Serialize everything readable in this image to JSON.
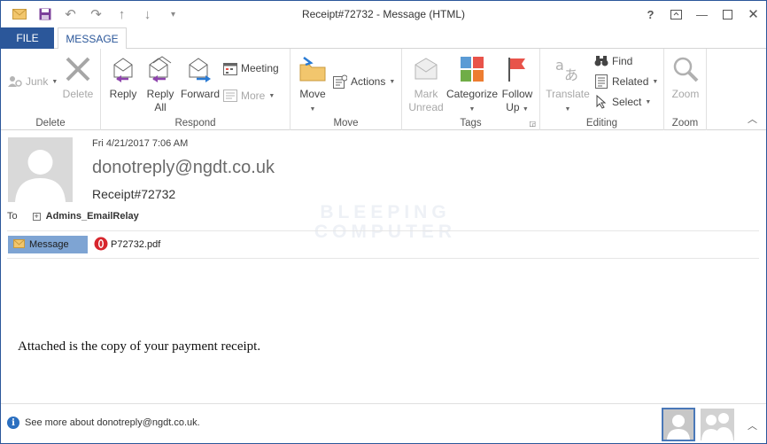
{
  "window": {
    "title": "Receipt#72732 - Message (HTML)",
    "help": "?"
  },
  "tabs": {
    "file": "FILE",
    "message": "MESSAGE"
  },
  "ribbon": {
    "delete_group": {
      "label": "Delete",
      "junk": "Junk",
      "delete": "Delete"
    },
    "respond_group": {
      "label": "Respond",
      "reply": "Reply",
      "reply_all_1": "Reply",
      "reply_all_2": "All",
      "forward": "Forward",
      "meeting": "Meeting",
      "more": "More"
    },
    "move_group": {
      "label": "Move",
      "move": "Move",
      "actions": "Actions"
    },
    "tags_group": {
      "label": "Tags",
      "mark_1": "Mark",
      "mark_2": "Unread",
      "categorize": "Categorize",
      "follow_1": "Follow",
      "follow_2": "Up"
    },
    "editing_group": {
      "label": "Editing",
      "translate": "Translate",
      "find": "Find",
      "related": "Related",
      "select": "Select"
    },
    "zoom_group": {
      "label": "Zoom",
      "zoom": "Zoom"
    }
  },
  "header": {
    "date": "Fri 4/21/2017 7:06 AM",
    "from": "donotreply@ngdt.co.uk",
    "subject": "Receipt#72732",
    "to_label": "To",
    "recipient": "Admins_EmailRelay",
    "watermark_1": "BLEEPING",
    "watermark_2": "COMPUTER"
  },
  "attachments": {
    "message_tab": "Message",
    "file": "P72732.pdf"
  },
  "body": {
    "text": "Attached is the copy of your payment receipt."
  },
  "footer": {
    "see_more": "See more about donotreply@ngdt.co.uk."
  },
  "colors": {
    "accent": "#2b579a",
    "flag": "#e8534a",
    "pdf": "#d7262d"
  }
}
